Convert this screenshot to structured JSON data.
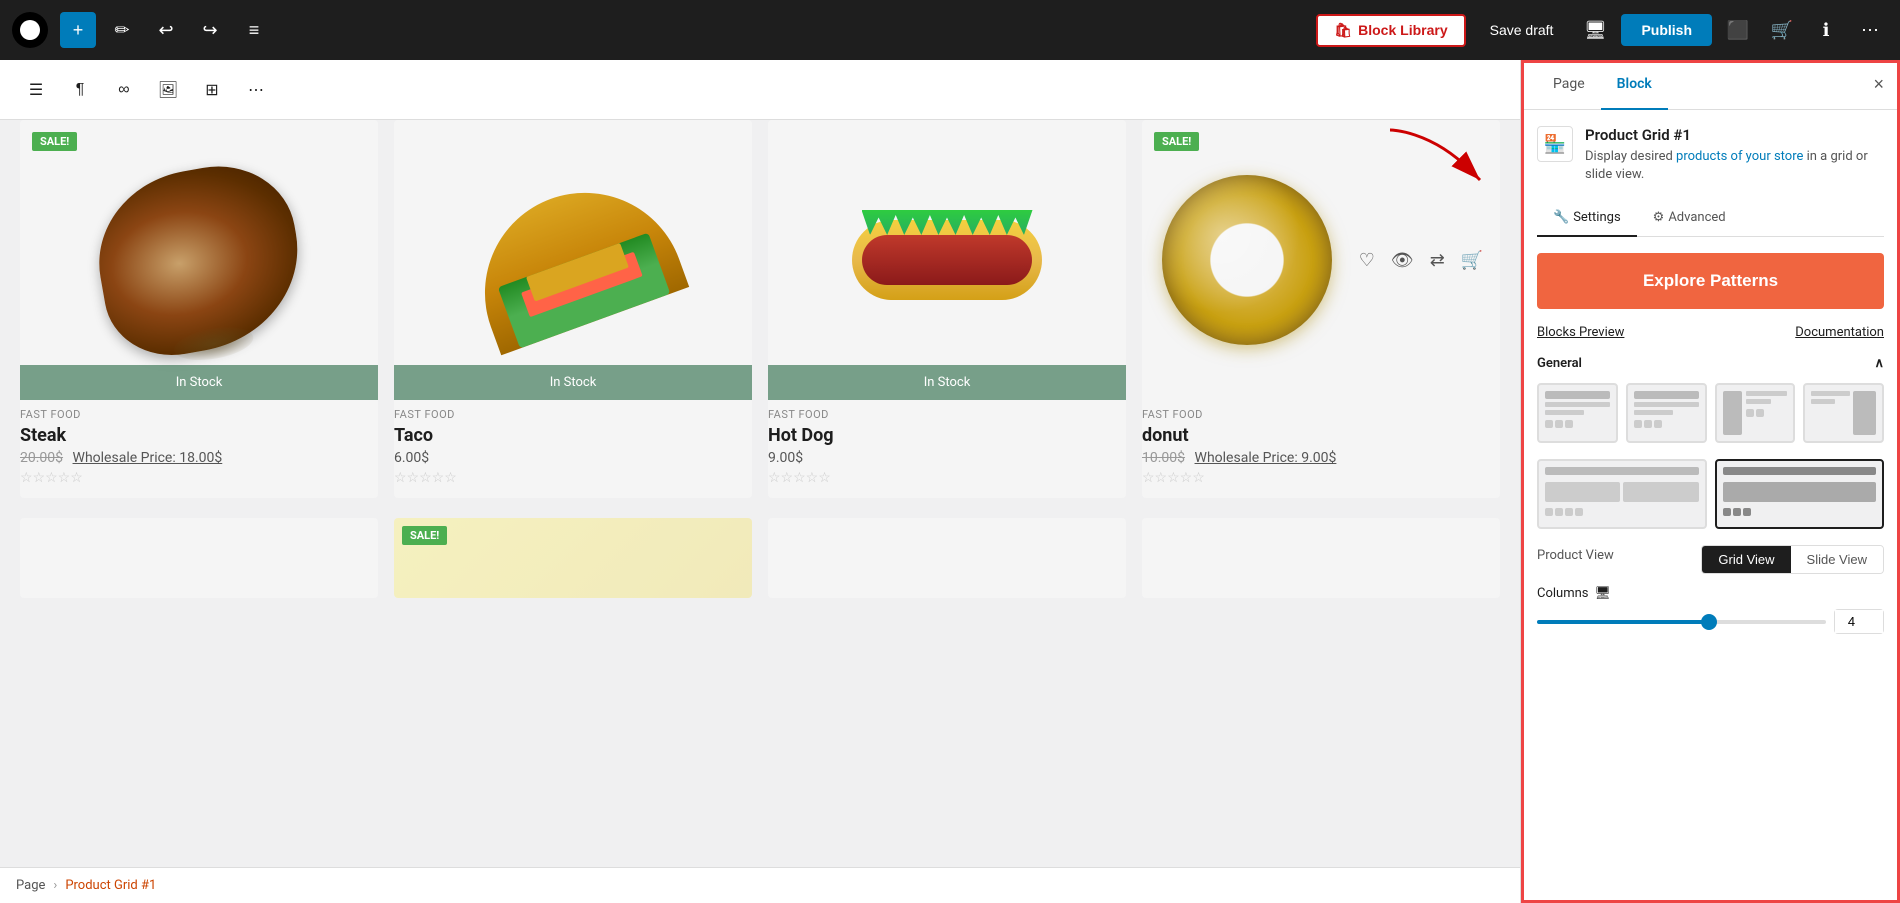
{
  "topbar": {
    "add_label": "+",
    "edit_label": "✏",
    "undo_label": "↩",
    "redo_label": "↪",
    "list_label": "≡",
    "block_library_label": "Block Library",
    "save_draft_label": "Save draft",
    "publish_label": "Publish",
    "view_icon": "🖥",
    "settings_icon": "⚙",
    "basket_icon": "🛒",
    "help_icon": "ℹ",
    "more_icon": "⋯"
  },
  "secondary_toolbar": {
    "list_view_icon": "☰",
    "paragraph_icon": "¶",
    "link_icon": "∞",
    "media_icon": "🖼",
    "table_icon": "⊞",
    "more_icon": "⋯"
  },
  "sidebar": {
    "page_tab": "Page",
    "block_tab": "Block",
    "close_icon": "×",
    "block_icon": "🏪",
    "block_name": "Product Grid #1",
    "block_desc_before": "Display desired ",
    "block_desc_link": "products of your store",
    "block_desc_after": " in a grid or slide view.",
    "settings_tab": "Settings",
    "advanced_tab": "Advanced",
    "explore_patterns_btn": "Explore Patterns",
    "blocks_preview_label": "Blocks Preview",
    "documentation_label": "Documentation",
    "general_label": "General",
    "collapse_icon": "∧",
    "product_view_label": "Product View",
    "grid_view_btn": "Grid View",
    "slide_view_btn": "Slide View",
    "columns_label": "Columns",
    "columns_value": "4",
    "slider_value": 60
  },
  "products": [
    {
      "id": 1,
      "sale": true,
      "in_stock": true,
      "category": "FAST FOOD",
      "name": "Steak",
      "price_strike": "20.00$",
      "wholesale": "Wholesale Price: 18.00$",
      "rating": "★★★★★",
      "shape": "steak"
    },
    {
      "id": 2,
      "sale": false,
      "in_stock": true,
      "category": "FAST FOOD",
      "name": "Taco",
      "price": "6.00$",
      "rating": "★★★★★",
      "shape": "taco"
    },
    {
      "id": 3,
      "sale": false,
      "in_stock": true,
      "category": "FAST FOOD",
      "name": "Hot Dog",
      "price": "9.00$",
      "rating": "★★★★★",
      "shape": "hotdog"
    },
    {
      "id": 4,
      "sale": true,
      "in_stock": false,
      "category": "FAST FOOD",
      "name": "donut",
      "price_strike": "10.00$",
      "wholesale": "Wholesale Price: 9.00$",
      "rating": "★★★★★",
      "shape": "donut"
    }
  ],
  "statusbar": {
    "page_label": "Page",
    "breadcrumb_sep": "›",
    "current_label": "Product Grid #1"
  }
}
